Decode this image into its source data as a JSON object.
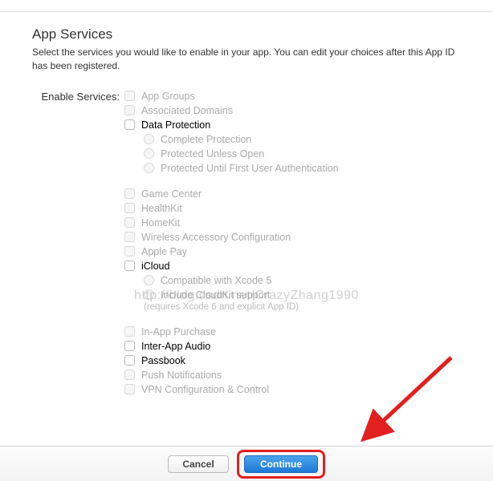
{
  "header": {
    "title": "App Services",
    "subtitle": "Select the services you would like to enable in your app. You can edit your choices after this App ID has been registered."
  },
  "form": {
    "enable_label": "Enable Services:"
  },
  "services": {
    "app_groups": "App Groups",
    "associated_domains": "Associated Domains",
    "data_protection": "Data Protection",
    "dp_complete": "Complete Protection",
    "dp_unless_open": "Protected Unless Open",
    "dp_first_user": "Protected Until First User Authentication",
    "game_center": "Game Center",
    "healthkit": "HealthKit",
    "homekit": "HomeKit",
    "wireless_accessory": "Wireless Accessory Configuration",
    "apple_pay": "Apple Pay",
    "icloud": "iCloud",
    "icloud_xcode5": "Compatible with Xcode 5",
    "icloud_cloudkit": "Include CloudKit support",
    "icloud_note": "(requires Xcode 6 and explicit App ID)",
    "in_app_purchase": "In-App Purchase",
    "inter_app_audio": "Inter-App Audio",
    "passbook": "Passbook",
    "push_notifications": "Push Notifications",
    "vpn": "VPN Configuration & Control"
  },
  "footer": {
    "cancel": "Cancel",
    "continue": "Continue"
  },
  "watermark": "http://blog.csdn.net/CrazyZhang1990",
  "annotation": {
    "arrow_color": "#e1201f"
  }
}
